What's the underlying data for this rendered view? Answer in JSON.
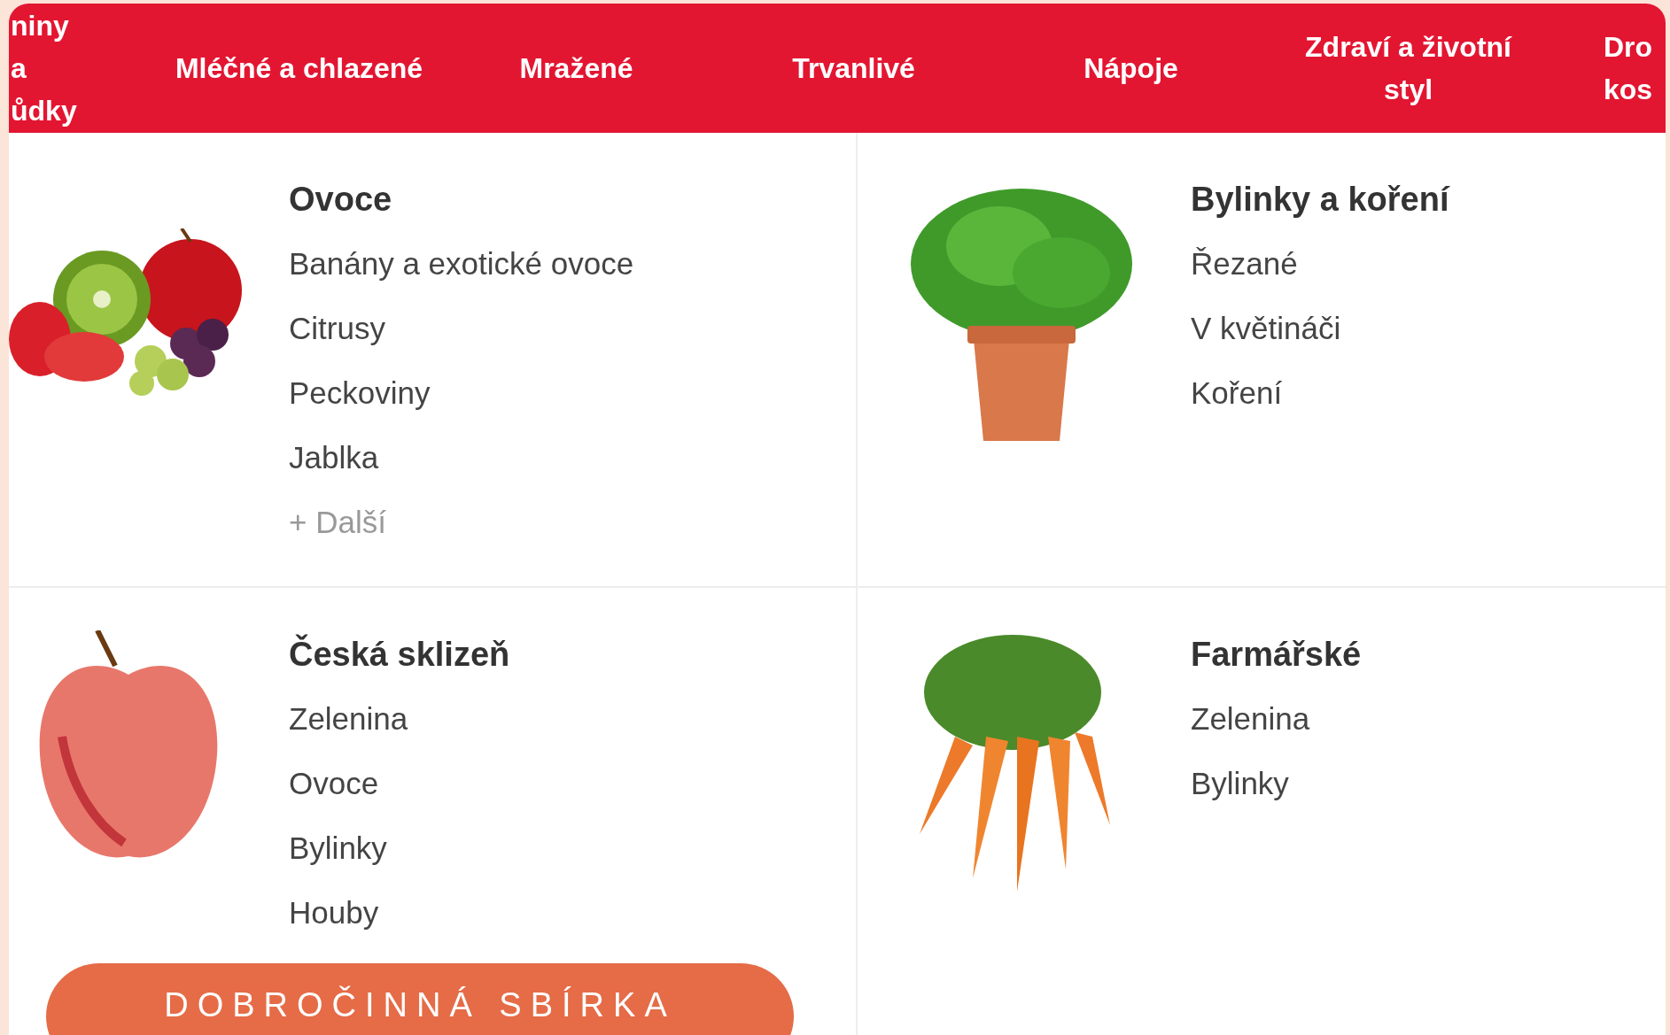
{
  "nav": [
    {
      "label": "niny a ůdky"
    },
    {
      "label": "Mléčné a chlazené"
    },
    {
      "label": "Mražené"
    },
    {
      "label": "Trvanlivé"
    },
    {
      "label": "Nápoje"
    },
    {
      "label": "Zdraví a životní styl"
    },
    {
      "label": "Dro kos"
    }
  ],
  "categories": [
    {
      "kind": "fruit",
      "title": "Ovoce",
      "items": [
        "Banány a exotické ovoce",
        "Citrusy",
        "Peckoviny",
        "Jablka"
      ],
      "more": "+ Další"
    },
    {
      "kind": "herb",
      "title": "Bylinky a koření",
      "items": [
        "Řezané",
        "V květináči",
        "Koření"
      ]
    },
    {
      "kind": "apple",
      "title": "Česká sklizeň",
      "items": [
        "Zelenina",
        "Ovoce",
        "Bylinky",
        "Houby"
      ]
    },
    {
      "kind": "carrot",
      "title": "Farmářské",
      "items": [
        "Zelenina",
        "Bylinky"
      ]
    }
  ],
  "charity_button": "DOBROČINNÁ SBÍRKA"
}
